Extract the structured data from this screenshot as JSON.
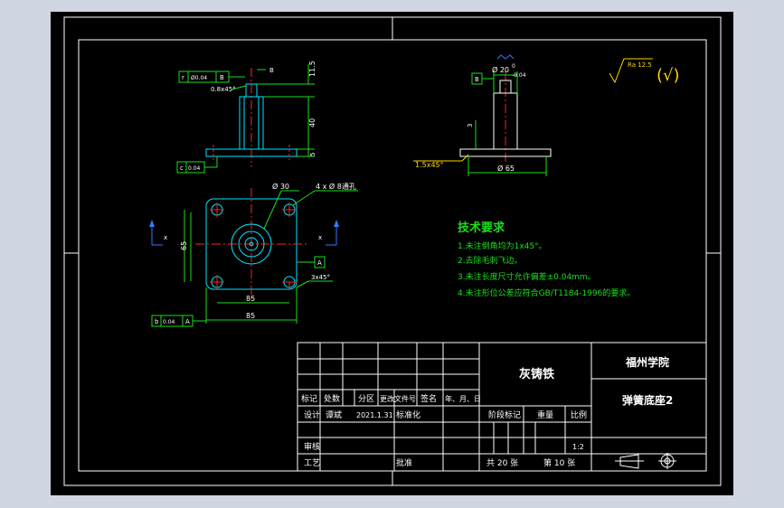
{
  "drawing": {
    "dims": {
      "d30": "Ø 30",
      "holes": "4 x Ø 8通孔",
      "d40": "40",
      "d85_inner": "85",
      "d85_outer": "85",
      "d65": "65",
      "chamfer_small": "0.8x45°",
      "chamfer_plate": "3x45°",
      "height_11": "11.5",
      "height_40": "40",
      "thick_5": "5",
      "b_label": "B",
      "x_label": "x",
      "d20": "Ø 20",
      "d20_tol_up": "0",
      "d20_tol_dn": "-0.04",
      "d65_section": "Ø 65",
      "gap_3": "3",
      "chamfer_section": "1.5x45°",
      "surface": "Ra 12.5",
      "general_mark": "(√)"
    },
    "frames": {
      "f1_sym": "r",
      "f1_val": "Ø0.04",
      "f1_datum": "B",
      "f2_sym": "c",
      "f2_val": "0.04",
      "f3_sym": "b",
      "f3_val": "0.04",
      "f3_datum": "A",
      "section_datum": "B",
      "datum_a": "A"
    },
    "tech": {
      "title": "技术要求",
      "lines": [
        "1.未注倒角均为1x45°。",
        "2.去除毛刺飞边。",
        "3.未注长度尺寸允许偏差±0.04mm。",
        "4.未注形位公差应符合GB/T1184-1996的要求。"
      ]
    },
    "title_block": {
      "material": "灰铸铁",
      "school": "福州学院",
      "part_name": "弹簧底座2",
      "col_biaoji": "标记",
      "col_chushu": "处数",
      "col_fenqu": "分区",
      "col_doc": "更改文件号",
      "col_sign": "签名",
      "col_date": "年、月、日",
      "design_label": "设计",
      "designer": "谭斌",
      "design_date": "2021.1.31",
      "standard": "标准化",
      "stage_label": "阶段标记",
      "weight_label": "重量",
      "scale_label": "比例",
      "scale_value": "1:2",
      "review_label": "审核",
      "process_label": "工艺",
      "approve_label": "批准",
      "sheets_total": "共 20 张",
      "sheet_no": "第 10 张"
    }
  }
}
